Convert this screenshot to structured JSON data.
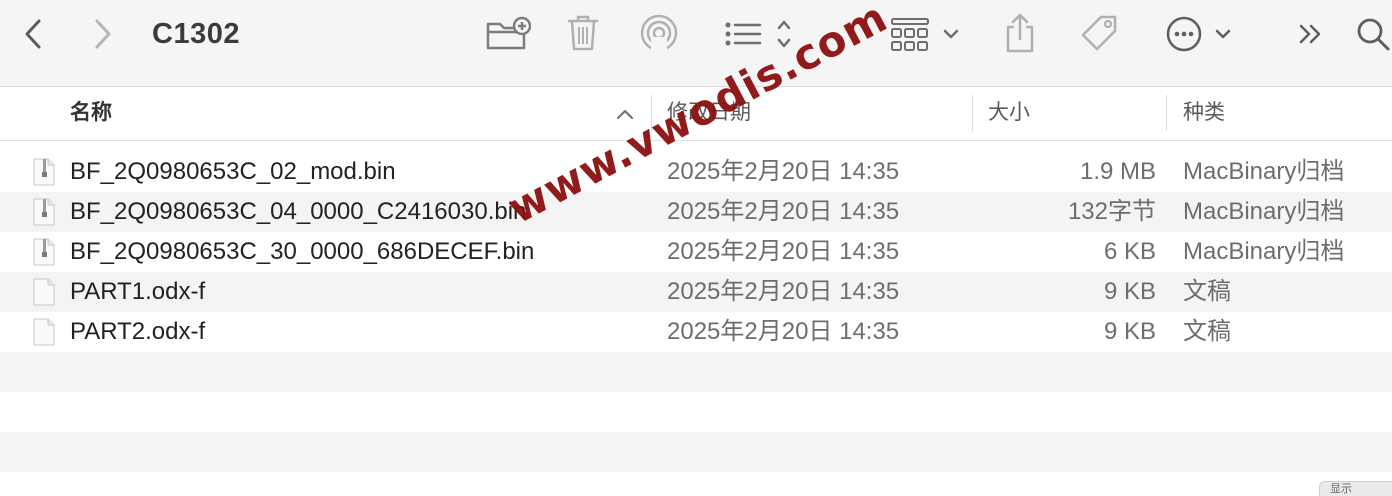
{
  "window": {
    "title": "C1302"
  },
  "toolbar": {
    "back": "chevron-left-icon",
    "forward": "chevron-right-icon",
    "new_folder": "folder-plus-icon",
    "trash": "trash-icon",
    "airdrop": "airdrop-icon",
    "list_view": "list-icon",
    "group": "grid-icon",
    "share": "share-icon",
    "tag": "tag-icon",
    "more": "ellipsis-circle-icon",
    "overflow": "double-chevron-right-icon",
    "search": "search-icon"
  },
  "columns": {
    "name": "名称",
    "date": "修改日期",
    "size": "大小",
    "kind": "种类"
  },
  "files": [
    {
      "name": "BF_2Q0980653C_02_mod.bin",
      "date": "2025年2月20日 14:35",
      "size": "1.9 MB",
      "kind": "MacBinary归档",
      "icon": "zip-file-icon"
    },
    {
      "name": "BF_2Q0980653C_04_0000_C2416030.bin",
      "date": "2025年2月20日 14:35",
      "size": "132字节",
      "kind": "MacBinary归档",
      "icon": "zip-file-icon"
    },
    {
      "name": "BF_2Q0980653C_30_0000_686DECEF.bin",
      "date": "2025年2月20日 14:35",
      "size": "6 KB",
      "kind": "MacBinary归档",
      "icon": "zip-file-icon"
    },
    {
      "name": "PART1.odx-f",
      "date": "2025年2月20日 14:35",
      "size": "9 KB",
      "kind": "文稿",
      "icon": "document-icon"
    },
    {
      "name": "PART2.odx-f",
      "date": "2025年2月20日 14:35",
      "size": "9 KB",
      "kind": "文稿",
      "icon": "document-icon"
    }
  ],
  "watermark": "www.vwodis.com",
  "corner_text": "显示"
}
